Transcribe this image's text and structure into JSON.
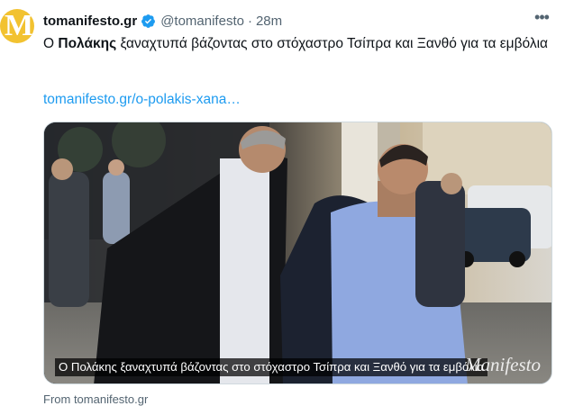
{
  "tweet": {
    "avatar_letter": "M",
    "display_name": "tomanifesto.gr",
    "handle": "@tomanifesto",
    "separator": "·",
    "time": "28m",
    "more_label": "•••",
    "text_before": "Ο ",
    "text_bold": "Πολάκης",
    "text_after": " ξαναχτυπά βάζοντας στο στόχαστρο Τσίπρα και Ξανθό για τα εμβόλια",
    "link_text": "tomanifesto.gr/o-polakis-xana…",
    "media": {
      "caption": "Ο Πολάκης ξαναχτυπά βάζοντας στο στόχαστρο Τσίπρα και Ξανθό για τα εμβόλια",
      "watermark": "Manifesto"
    },
    "footer_from": "From tomanifesto.gr"
  },
  "colors": {
    "link": "#1d9bf0",
    "secondary_text": "#536471",
    "avatar_bg": "#f2c230",
    "verified": "#1d9bf0"
  }
}
